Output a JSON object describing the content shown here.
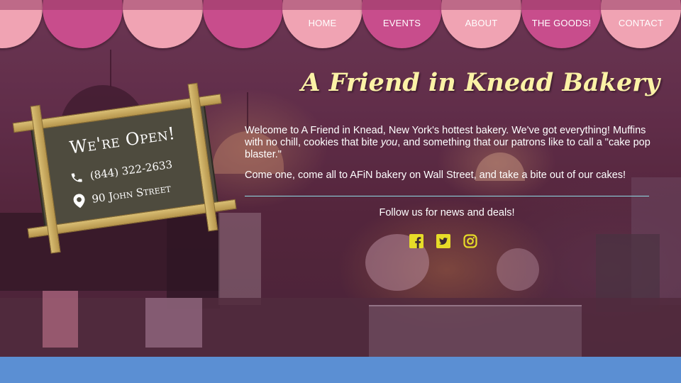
{
  "nav": {
    "items": [
      {
        "label": "HOME"
      },
      {
        "label": "EVENTS"
      },
      {
        "label": "ABOUT"
      },
      {
        "label": "THE GOODS!"
      },
      {
        "label": "CONTACT"
      }
    ]
  },
  "sign": {
    "title": "We're Open!",
    "phone": "(844) 322-2633",
    "address": "90 John Street"
  },
  "main": {
    "title": "A Friend in Knead Bakery",
    "intro_before": "Welcome to A Friend in Knead, New York's hottest bakery. We've got everything! Muffins with no chill, cookies that bite ",
    "intro_em": "you",
    "intro_after": ", and something that our patrons like to call a \"cake pop blaster.\"",
    "invite": "Come one, come all to AFiN bakery on Wall Street, and take a bite out of our cakes!",
    "follow": "Follow us for news and deals!"
  },
  "socials": [
    {
      "icon": "facebook-icon"
    },
    {
      "icon": "twitter-icon"
    },
    {
      "icon": "instagram-icon"
    }
  ],
  "colors": {
    "scallop_light": "#f0a3b3",
    "scallop_dark": "#c84d8c",
    "title": "#fbf2a6",
    "social": "#e6dc28",
    "rule": "#8fdce6",
    "footer": "#5b8fd3"
  }
}
